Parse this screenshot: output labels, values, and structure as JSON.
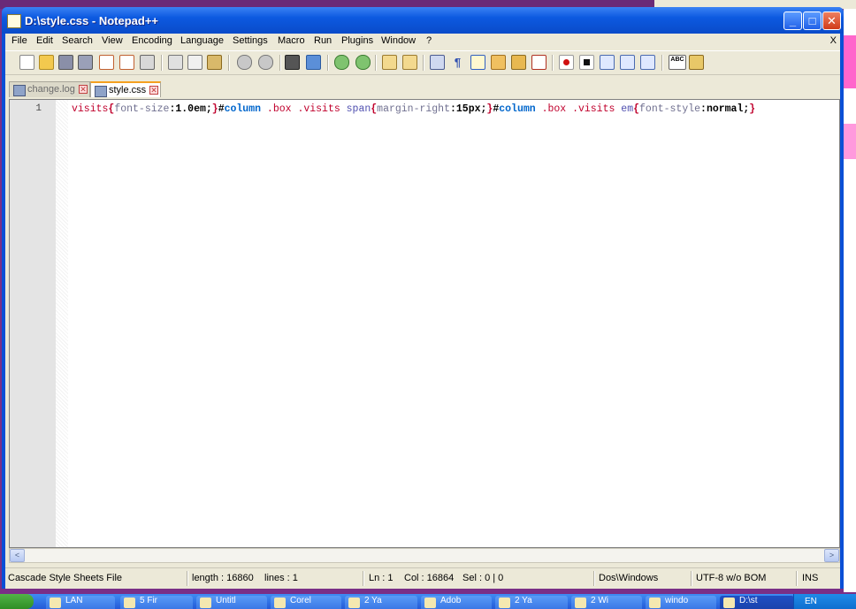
{
  "window": {
    "title": "D:\\style.css - Notepad++",
    "minimize_glyph": "_",
    "maximize_glyph": "□",
    "close_glyph": "✕"
  },
  "menu": {
    "items": [
      "File",
      "Edit",
      "Search",
      "View",
      "Encoding",
      "Language",
      "Settings",
      "Macro",
      "Run",
      "Plugins",
      "Window",
      "?"
    ],
    "close_glyph": "X"
  },
  "toolbar": {
    "buttons": [
      "new-file-icon",
      "open-file-icon",
      "save-icon",
      "save-all-icon",
      "close-icon",
      "close-all-icon",
      "print-icon",
      "cut-icon",
      "copy-icon",
      "paste-icon",
      "undo-icon",
      "redo-icon",
      "find-icon",
      "replace-icon",
      "zoom-in-icon",
      "zoom-out-icon",
      "sync-vertical-icon",
      "sync-horizontal-icon",
      "word-wrap-icon",
      "show-all-chars-icon",
      "indent-guide-icon",
      "doc-map-icon",
      "function-list-icon",
      "folder-workspace-icon",
      "record-macro-icon",
      "stop-record-icon",
      "play-macro-icon",
      "run-macro-multiple-icon",
      "save-macro-icon",
      "spell-check-icon",
      "more-icon"
    ]
  },
  "tabs": [
    {
      "label": "change.log",
      "active": false
    },
    {
      "label": "style.css",
      "active": true
    }
  ],
  "editor": {
    "line_number": "1",
    "tokens": [
      {
        "t": "visits",
        "c": "c-sel"
      },
      {
        "t": "{",
        "c": "c-brace"
      },
      {
        "t": "font-size",
        "c": "c-prop"
      },
      {
        "t": ":",
        "c": "c-punc"
      },
      {
        "t": "1.0em",
        "c": "c-val"
      },
      {
        "t": ";",
        "c": "c-punc"
      },
      {
        "t": "}",
        "c": "c-brace"
      },
      {
        "t": "#",
        "c": "c-punc"
      },
      {
        "t": "column",
        "c": "c-id"
      },
      {
        "t": " ",
        "c": "c-punc"
      },
      {
        "t": ".box",
        "c": "c-cls"
      },
      {
        "t": " ",
        "c": "c-punc"
      },
      {
        "t": ".visits",
        "c": "c-cls"
      },
      {
        "t": " ",
        "c": "c-punc"
      },
      {
        "t": "span",
        "c": "c-tag"
      },
      {
        "t": "{",
        "c": "c-brace"
      },
      {
        "t": "margin-right",
        "c": "c-prop"
      },
      {
        "t": ":",
        "c": "c-punc"
      },
      {
        "t": "15px",
        "c": "c-val"
      },
      {
        "t": ";",
        "c": "c-punc"
      },
      {
        "t": "}",
        "c": "c-brace"
      },
      {
        "t": "#",
        "c": "c-punc"
      },
      {
        "t": "column",
        "c": "c-id"
      },
      {
        "t": " ",
        "c": "c-punc"
      },
      {
        "t": ".box",
        "c": "c-cls"
      },
      {
        "t": " ",
        "c": "c-punc"
      },
      {
        "t": ".visits",
        "c": "c-cls"
      },
      {
        "t": " ",
        "c": "c-punc"
      },
      {
        "t": "em",
        "c": "c-tag"
      },
      {
        "t": "{",
        "c": "c-brace"
      },
      {
        "t": "font-style",
        "c": "c-prop"
      },
      {
        "t": ":",
        "c": "c-punc"
      },
      {
        "t": "normal",
        "c": "c-val"
      },
      {
        "t": ";",
        "c": "c-punc"
      },
      {
        "t": "}",
        "c": "c-brace"
      }
    ]
  },
  "scrollbar": {
    "left_glyph": "<",
    "right_glyph": ">"
  },
  "status": {
    "file_type": "Cascade Style Sheets File",
    "length": "length : 16860",
    "lines": "lines : 1",
    "ln": "Ln : 1",
    "col": "Col : 16864",
    "sel": "Sel : 0 | 0",
    "eol": "Dos\\Windows",
    "encoding": "UTF-8 w/o BOM",
    "mode": "INS"
  },
  "taskbar": {
    "items": [
      "LAN",
      "5 Fir",
      "Untitl",
      "Corel",
      "2 Ya",
      "Adob",
      "2 Ya",
      "2 Wi",
      "windo",
      "D:\\st"
    ],
    "tray": "EN"
  }
}
